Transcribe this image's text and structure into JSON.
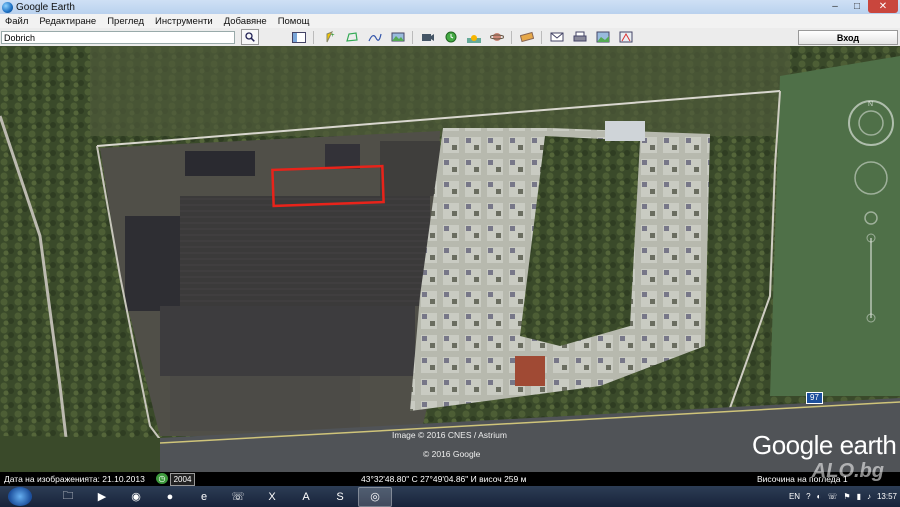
{
  "window": {
    "title": "Google Earth",
    "minimize": "–",
    "maximize": "□",
    "close": "✕"
  },
  "menu": [
    "Файл",
    "Редактиране",
    "Преглед",
    "Инструменти",
    "Добавяне",
    "Помощ"
  ],
  "search": {
    "value": "Dobrich"
  },
  "signin": {
    "label": "Вход"
  },
  "toolbar_icons": [
    "sidebar-icon",
    "placemark-icon",
    "polygon-icon",
    "path-icon",
    "image-overlay-icon",
    "record-tour-icon",
    "historical-imagery-icon",
    "sunlight-icon",
    "planets-icon",
    "ruler-icon",
    "email-icon",
    "print-icon",
    "save-image-icon",
    "maps-icon"
  ],
  "map": {
    "copyright": "Image © 2016 CNES / Astrium",
    "copyright2": "© 2016 Google",
    "logo": "Google earth",
    "road_sign": "97",
    "highlight_color": "#e8231a"
  },
  "status": {
    "date": "Дата на изображенията: 21.10.2013",
    "year": "2004",
    "coords": "43°32'48.80\" С   27°49'04.86\" И  височ    259 м",
    "altitude": "Височина на погледа 1"
  },
  "taskbar": {
    "items": [
      "explorer",
      "media-player",
      "chrome",
      "firefox",
      "ie",
      "viber",
      "excel",
      "acrobat",
      "skype",
      "google-earth"
    ],
    "lang": "EN",
    "clock": "13:57"
  },
  "watermark": "ALO.bg"
}
